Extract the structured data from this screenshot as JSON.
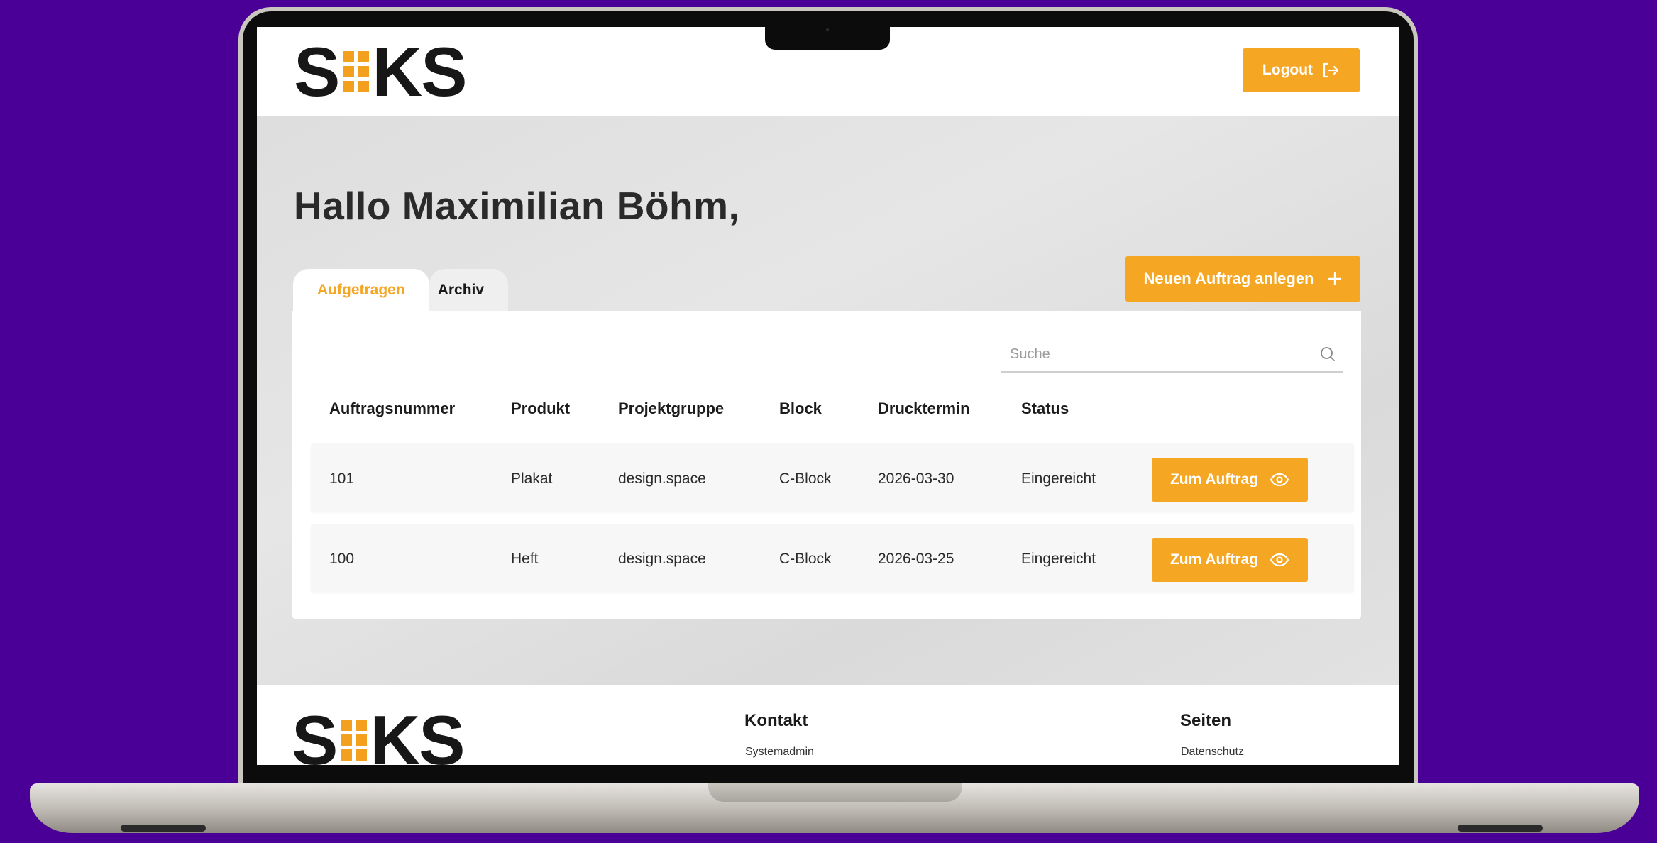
{
  "header": {
    "logo_text_left": "S",
    "logo_text_right": "KS",
    "logout_label": "Logout"
  },
  "main": {
    "greeting": "Hallo Maximilian Böhm,",
    "tabs": [
      {
        "label": "Aufgetragen",
        "active": true
      },
      {
        "label": "Archiv",
        "active": false
      }
    ],
    "new_order_label": "Neuen Auftrag anlegen",
    "search": {
      "placeholder": "Suche",
      "value": ""
    },
    "table": {
      "headers": [
        "Auftragsnummer",
        "Produkt",
        "Projektgruppe",
        "Block",
        "Drucktermin",
        "Status"
      ],
      "rows": [
        {
          "nummer": "101",
          "produkt": "Plakat",
          "projektgruppe": "design.space",
          "block": "C-Block",
          "drucktermin": "2026-03-30",
          "status": "Eingereicht",
          "action": "Zum Auftrag"
        },
        {
          "nummer": "100",
          "produkt": "Heft",
          "projektgruppe": "design.space",
          "block": "C-Block",
          "drucktermin": "2026-03-25",
          "status": "Eingereicht",
          "action": "Zum Auftrag"
        }
      ]
    }
  },
  "footer": {
    "logo_text_left": "S",
    "logo_text_right": "KS",
    "contact": {
      "heading": "Kontakt",
      "link": "Systemadmin"
    },
    "pages": {
      "heading": "Seiten",
      "link": "Datenschutz"
    }
  },
  "colors": {
    "background": "#4a0096",
    "accent": "#f5a623",
    "screen_bg": "#e1e1e1"
  },
  "icons": {
    "logout": "logout-arrow-icon",
    "add": "plus-icon",
    "search": "search-icon",
    "view": "eye-icon"
  }
}
